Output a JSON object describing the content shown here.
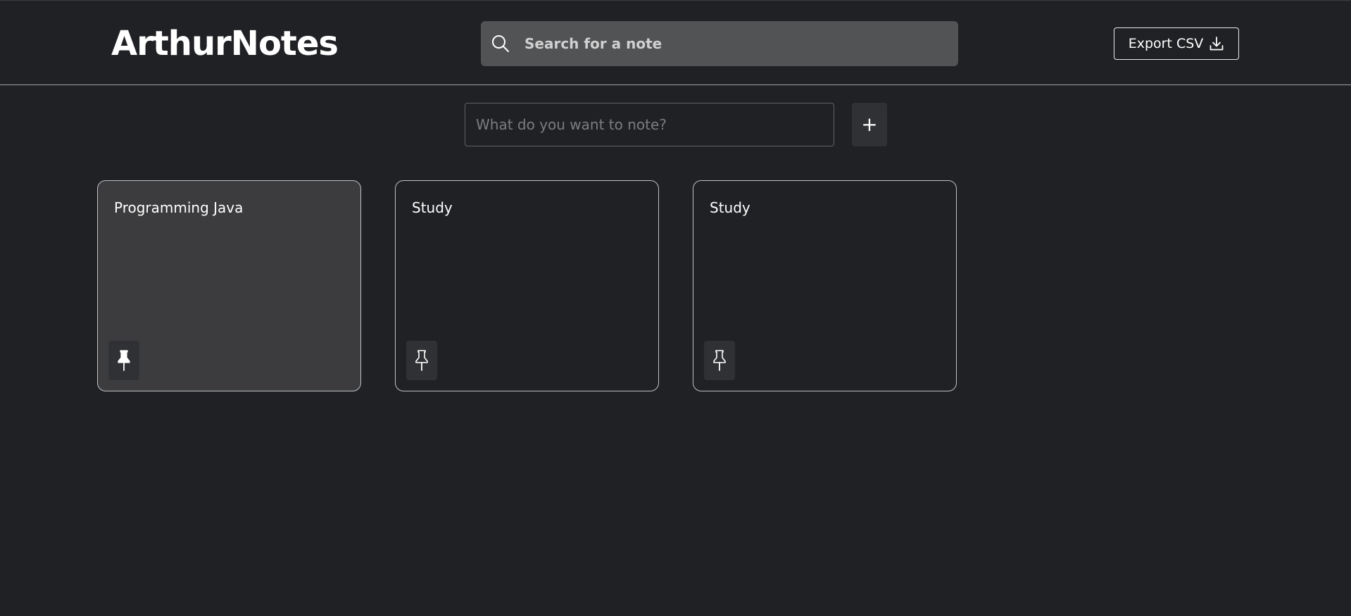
{
  "app": {
    "title": "ArthurNotes"
  },
  "search": {
    "placeholder": "Search for a note",
    "value": "",
    "icon": "search-icon"
  },
  "toolbar": {
    "export_label": "Export CSV",
    "export_icon": "download-icon"
  },
  "composer": {
    "placeholder": "What do you want to note?",
    "value": "",
    "add_label": "+"
  },
  "notes": [
    {
      "title": "Programming Java",
      "pinned": true,
      "pin_icon": "pin-filled-icon"
    },
    {
      "title": "Study",
      "pinned": false,
      "pin_icon": "pin-outline-icon"
    },
    {
      "title": "Study",
      "pinned": false,
      "pin_icon": "pin-outline-icon"
    }
  ],
  "colors": {
    "background": "#202124",
    "surface": "#303134",
    "pinned_card": "#3c3c3e",
    "search_bg": "#525355",
    "border": "#bdc1c6",
    "text": "#ffffff"
  }
}
